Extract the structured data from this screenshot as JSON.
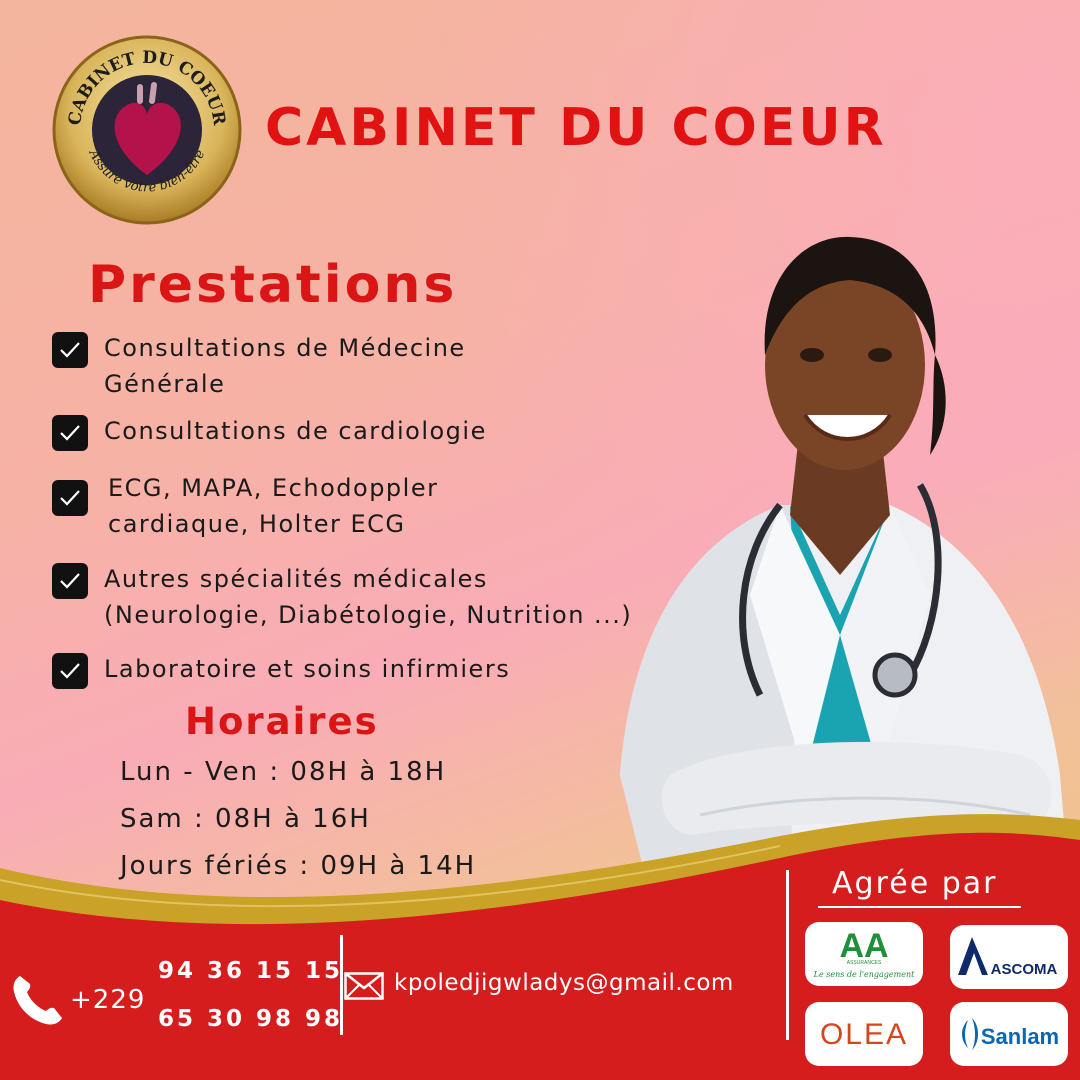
{
  "brand": {
    "name": "CABINET DU COEUR",
    "logo_arc_top": "CABINET DU COEUR",
    "logo_arc_bottom": "Assure votre bien-être"
  },
  "services": {
    "title": "Prestations",
    "items": [
      "Consultations de Médecine\nGénérale",
      "Consultations de cardiologie",
      "ECG, MAPA, Echodoppler\ncardiaque, Holter ECG",
      "Autres spécialités médicales\n(Neurologie, Diabétologie, Nutrition ...)",
      "Laboratoire et soins infirmiers"
    ]
  },
  "hours": {
    "title": "Horaires",
    "lines": [
      "Lun - Ven : 08H à 18H",
      "Sam : 08H à 16H",
      "Jours fériés : 09H à 14H"
    ]
  },
  "contact": {
    "phone_prefix": "+229",
    "phones": [
      "94 36 15 15",
      "65 30 98 98"
    ],
    "email": "kpoledjigwladys@gmail.com"
  },
  "approval": {
    "title": "Agrée par",
    "partners": [
      {
        "name": "AA",
        "tagline": "Le sens de l'engagement",
        "small": "ASSURANCES"
      },
      {
        "name": "ASCOMA"
      },
      {
        "name": "OLEA"
      },
      {
        "name": "Sanlam"
      }
    ]
  },
  "colors": {
    "accent_red": "#e01212",
    "band_red": "#d51d1d",
    "gold": "#c9a227"
  },
  "icons": [
    "check-icon",
    "phone-icon",
    "mail-icon",
    "heart-logo-icon"
  ]
}
